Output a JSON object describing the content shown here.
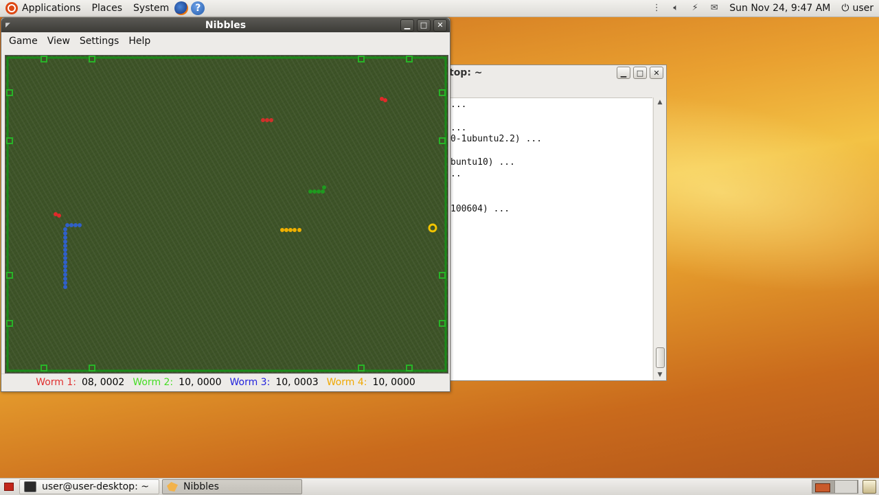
{
  "top_panel": {
    "menus": [
      "Applications",
      "Places",
      "System"
    ],
    "datetime": "Sun Nov 24,  9:47 AM",
    "user": "user"
  },
  "terminal": {
    "title": "top: ~",
    "lines": [
      "...",
      "",
      "...",
      "0-1ubuntu2.2) ...",
      "",
      "buntu10) ...",
      "..",
      "",
      "",
      "100604) ..."
    ]
  },
  "nibbles": {
    "title": "Nibbles",
    "menu": [
      "Game",
      "View",
      "Settings",
      "Help"
    ],
    "status": [
      {
        "label": "Worm 1:",
        "value": "08, 0002",
        "color": "#e03030"
      },
      {
        "label": "Worm 2:",
        "value": "10, 0000",
        "color": "#44dd22"
      },
      {
        "label": "Worm 3:",
        "value": "10, 0003",
        "color": "#2222dd"
      },
      {
        "label": "Worm 4:",
        "value": "10, 0000",
        "color": "#f0a800"
      }
    ]
  },
  "taskbar": {
    "tasks": [
      "user@user-desktop: ~",
      "Nibbles"
    ]
  },
  "colors": {
    "worm_red": "#d0302a",
    "worm_green": "#1f9a1f",
    "worm_blue": "#3060c8",
    "worm_yellow": "#f0b000",
    "wall": "#1a8a1a"
  }
}
